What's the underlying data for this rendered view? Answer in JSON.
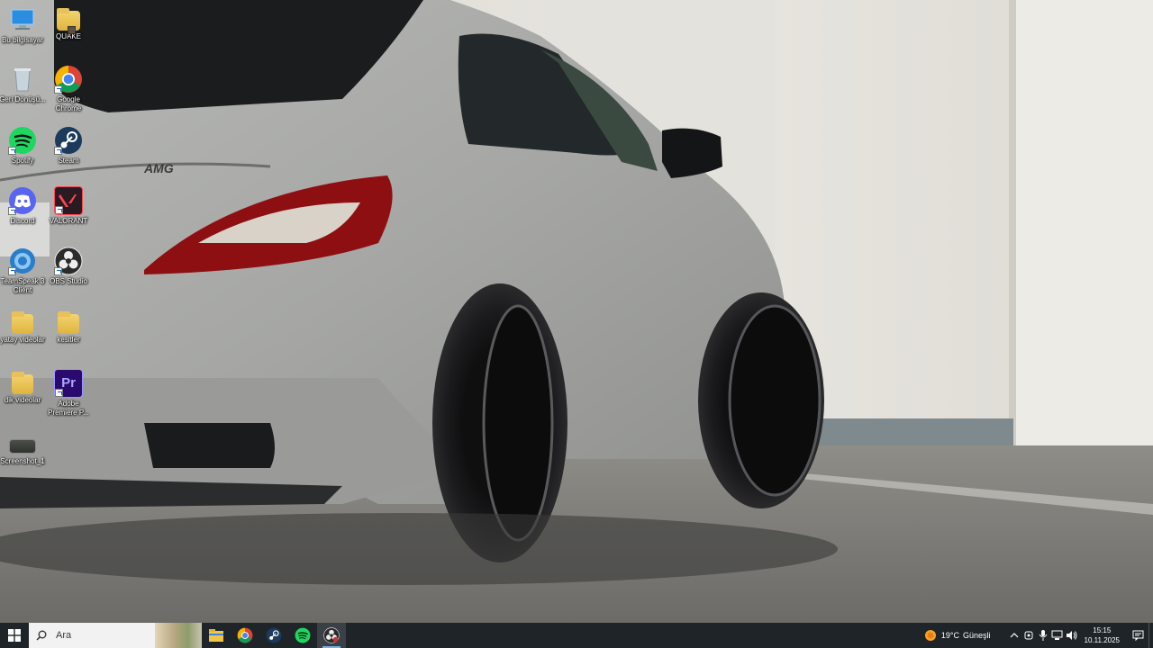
{
  "desktop": {
    "icons": [
      {
        "label": "Bu bilgisayar",
        "icon": "this-pc-icon"
      },
      {
        "label": "QUAKE",
        "icon": "folder-icon"
      },
      {
        "label": "Geri Dönüşü...",
        "icon": "recycle-bin-icon"
      },
      {
        "label": "Google Chrome",
        "icon": "chrome-icon"
      },
      {
        "label": "Spotify",
        "icon": "spotify-icon"
      },
      {
        "label": "Steam",
        "icon": "steam-icon"
      },
      {
        "label": "Discord",
        "icon": "discord-icon"
      },
      {
        "label": "VALORANT",
        "icon": "valorant-icon"
      },
      {
        "label": "TeamSpeak 3 Client",
        "icon": "teamspeak-icon"
      },
      {
        "label": "OBS Studio",
        "icon": "obs-icon"
      },
      {
        "label": "yatay videolar",
        "icon": "folder-icon"
      },
      {
        "label": "kesitler",
        "icon": "folder-icon"
      },
      {
        "label": "dik videolar",
        "icon": "folder-icon"
      },
      {
        "label": "Adobe Premiere P...",
        "icon": "premiere-icon"
      },
      {
        "label": "Screenshot_1",
        "icon": "image-file-icon"
      }
    ]
  },
  "taskbar": {
    "search_placeholder": "Ara",
    "apps": [
      "file-explorer-icon",
      "chrome-icon",
      "steam-icon",
      "spotify-icon",
      "obs-icon"
    ],
    "weather": {
      "temp": "19°C",
      "condition": "Güneşli"
    },
    "clock": {
      "time": "15:15",
      "date": "10.11.2025"
    }
  },
  "colors": {
    "taskbar": "#1f2428",
    "accent": "#7fb0e0",
    "spotify": "#1ed760",
    "discord": "#5865f2",
    "valorant": "#ff4655",
    "premiere": "#2a0a6e"
  }
}
